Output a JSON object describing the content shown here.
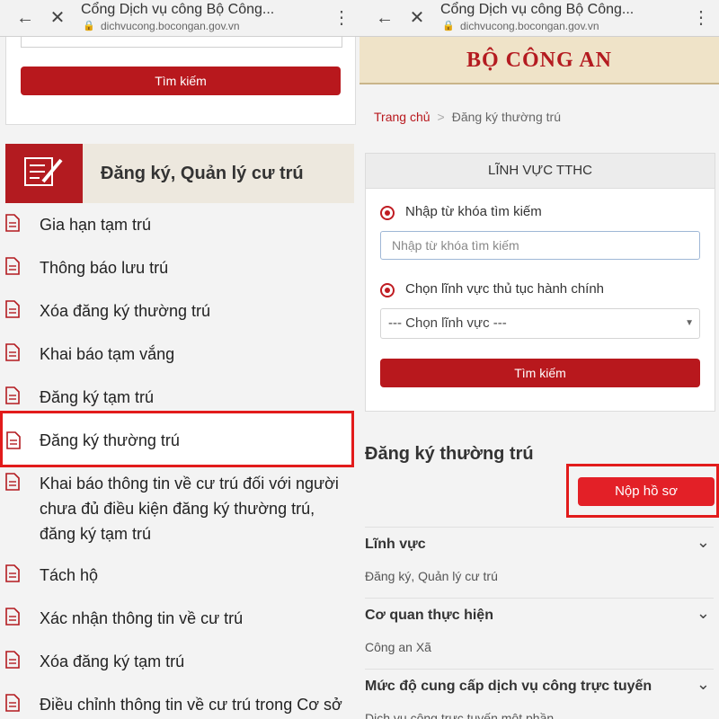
{
  "browser": {
    "title": "Cổng Dịch vụ công Bộ Công...",
    "url": "dichvucong.bocongan.gov.vn"
  },
  "left": {
    "search_button": "Tìm kiếm",
    "category_title": "Đăng ký, Quản lý cư trú",
    "items": [
      "Gia hạn tạm trú",
      "Thông báo lưu trú",
      "Xóa đăng ký thường trú",
      "Khai báo tạm vắng",
      "Đăng ký tạm trú",
      "Đăng ký thường trú",
      "Khai báo thông tin về cư trú đối với người chưa đủ điều kiện đăng ký thường trú, đăng ký tạm trú",
      "Tách hộ",
      "Xác nhận thông tin về cư trú",
      "Xóa đăng ký tạm trú",
      "Điều chỉnh thông tin về cư trú trong Cơ sở"
    ]
  },
  "right": {
    "banner": "BỘ CÔNG AN",
    "breadcrumb": {
      "home": "Trang chủ",
      "sep": ">",
      "current": "Đăng ký thường trú"
    },
    "tthc": {
      "header": "LĨNH VỰC TTHC",
      "radio_keyword": "Nhập từ khóa tìm kiếm",
      "keyword_placeholder": "Nhập từ khóa tìm kiếm",
      "radio_field": "Chọn lĩnh vực thủ tục hành chính",
      "select_value": "--- Chọn lĩnh vực ---",
      "search_button": "Tìm kiếm"
    },
    "section_title": "Đăng ký thường trú",
    "submit_button": "Nộp hồ sơ",
    "rows": [
      {
        "label": "Lĩnh vực",
        "value": "Đăng ký, Quản lý cư trú"
      },
      {
        "label": "Cơ quan thực hiện",
        "value": "Công an Xã"
      },
      {
        "label": "Mức độ cung cấp dịch vụ công trực tuyến",
        "value": "Dịch vụ công trực tuyến một phần"
      }
    ]
  },
  "colors": {
    "accent": "#b8181d",
    "highlight": "#e21b1b",
    "submit": "#e32027"
  }
}
